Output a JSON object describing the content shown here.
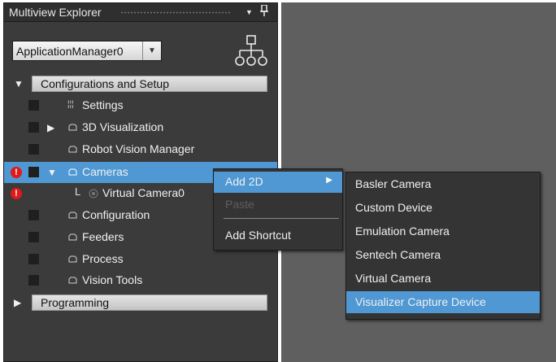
{
  "panel": {
    "title": "Multiview Explorer",
    "pin_glyph": "▼",
    "close_glyph": "⨆",
    "combo_value": "ApplicationManager0",
    "combo_arrow": "▼",
    "tree_icon": "hierarchy-icon"
  },
  "sections": {
    "configurations": {
      "label": "Configurations and Setup",
      "expander": "▼"
    },
    "programming": {
      "label": "Programming",
      "expander": "▶"
    }
  },
  "tree": {
    "settings": "Settings",
    "visualization_3d": "3D Visualization",
    "robot_vision_manager": "Robot Vision Manager",
    "cameras": "Cameras",
    "virtual_camera0": "Virtual Camera0",
    "configuration": "Configuration",
    "feeders": "Feeders",
    "process": "Process",
    "vision_tools": "Vision Tools",
    "expand_glyph": "▶",
    "collapse_glyph": "▼",
    "error_glyph": "!",
    "line_glyph": "L",
    "settings_glyph": "¦¦¦"
  },
  "context_menu": {
    "add_2d": "Add 2D",
    "paste": "Paste",
    "add_shortcut": "Add Shortcut",
    "submenu_arrow": "▶"
  },
  "submenu": {
    "items": [
      "Basler Camera",
      "Custom Device",
      "Emulation Camera",
      "Sentech Camera",
      "Virtual Camera",
      "Visualizer Capture Device"
    ]
  },
  "colors": {
    "panel_bg": "#3b3b3b",
    "selection": "#4f98d3",
    "error": "#e01a1a",
    "workspace": "#5f5f5f"
  }
}
